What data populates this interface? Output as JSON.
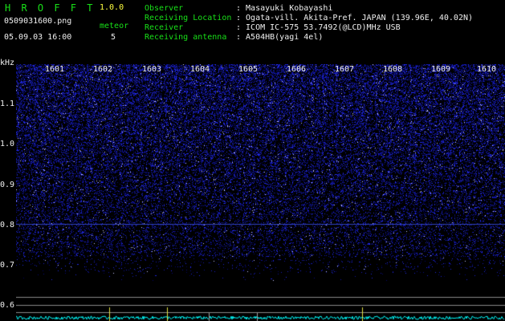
{
  "header": {
    "app_name": "H R O F F T",
    "version": "1.0.0",
    "filename": "0509031600.png",
    "datetime": "05.09.03 16:00",
    "meteor_label": "meteor",
    "meteor_count": "5",
    "observer_label": "Observer",
    "observer_value": ": Masayuki Kobayashi",
    "location_label": "Receiving Location",
    "location_value": ": Ogata-vill. Akita-Pref. JAPAN (139.96E, 40.02N)",
    "receiver_label": "Receiver",
    "receiver_value": ": ICOM IC-575 53.7492(@LCD)MHz USB",
    "antenna_label": "Receiving antenna",
    "antenna_value": ": A504HB(yagi 4el)"
  },
  "colors": {
    "label_green": "#18e018",
    "value_white": "#f0f0f0",
    "version_yellow": "#ffff40",
    "noise_blue": "#2030ff",
    "trace_cyan": "#00ffff"
  },
  "chart_data": {
    "type": "heatmap",
    "yunit": "kHz",
    "yticks": [
      "1.1",
      "1.0",
      "0.9",
      "0.8",
      "0.7",
      "0.6"
    ],
    "xticks": [
      "1601",
      "1602",
      "1603",
      "1604",
      "1605",
      "1606",
      "1607",
      "1608",
      "1609",
      "1610"
    ],
    "carrier_khz": 0.8
  }
}
